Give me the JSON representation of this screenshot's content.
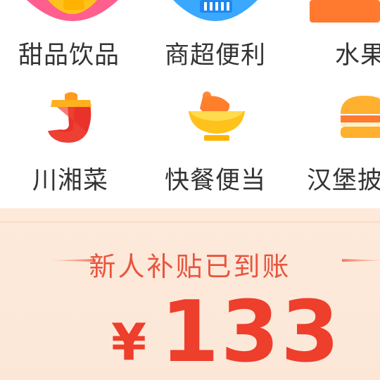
{
  "categories": [
    {
      "label": "甜品饮品",
      "icon": "dessert-drink-icon"
    },
    {
      "label": "商超便利",
      "icon": "supermarket-basket-icon"
    },
    {
      "label": "水果",
      "icon": "fruit-icon"
    },
    {
      "label": "川湘菜",
      "icon": "chili-pepper-icon"
    },
    {
      "label": "快餐便当",
      "icon": "fast-food-bowl-icon"
    },
    {
      "label": "汉堡披",
      "icon": "burger-icon"
    }
  ],
  "promo": {
    "title": "新人补贴已到账",
    "currency": "¥",
    "amount": "133"
  },
  "colors": {
    "accent_red": "#ee3e2c",
    "title_red": "#e8553f",
    "promo_bg": "#fdeadb"
  }
}
